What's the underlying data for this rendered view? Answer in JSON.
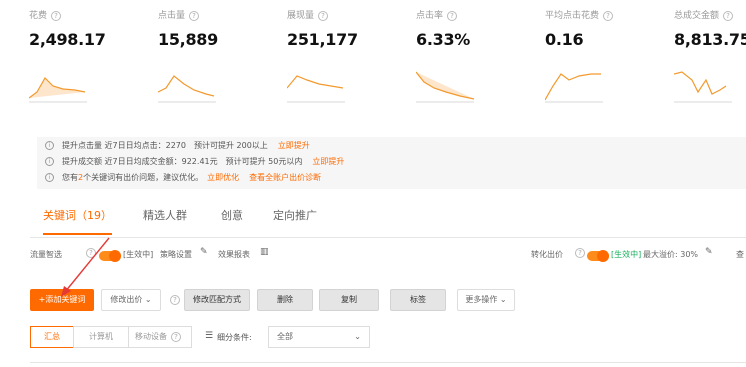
{
  "metrics": [
    {
      "label": "花费",
      "value": "2,498.17"
    },
    {
      "label": "点击量",
      "value": "15,889"
    },
    {
      "label": "展现量",
      "value": "251,177"
    },
    {
      "label": "点击率",
      "value": "6.33%"
    },
    {
      "label": "平均点击花费",
      "value": "0.16"
    },
    {
      "label": "总成交金额",
      "value": "8,813.75"
    }
  ],
  "help_glyph": "?",
  "alerts": [
    {
      "text": "提升点击量 近7日日均点击：2270　预计可提升 200以上",
      "link": "立即提升"
    },
    {
      "text": "提升成交额 近7日日均成交金额：922.41元　预计可提升 50元以内",
      "link": "立即提升"
    },
    {
      "pre": "您有",
      "count": "2",
      "post": "个关键词有出价问题，建议优化。",
      "link": "立即优化",
      "link2": "查看全账户出价诊断"
    }
  ],
  "tabs": [
    {
      "label": "关键词（19）",
      "active": true
    },
    {
      "label": "精选人群"
    },
    {
      "label": "创意"
    },
    {
      "label": "定向推广"
    }
  ],
  "controls": {
    "traffic_label": "流量智选",
    "traffic_status": "[生效中]",
    "strategy_label": "策略设置",
    "report_label": "效果报表",
    "conversion_label": "转化出价",
    "conversion_status": "[生效中]",
    "conversion_detail": "最大溢价: 30%",
    "edge_text": "查"
  },
  "toolbar": {
    "add_keyword": "+添加关键词",
    "modify_bid": "修改出价",
    "modify_match": "修改匹配方式",
    "delete": "删除",
    "copy": "复制",
    "tag": "标签",
    "more": "更多操作"
  },
  "filter": {
    "summary": "汇总",
    "computer": "计算机",
    "mobile": "移动设备",
    "condition_label": "细分条件:",
    "condition_value": "全部"
  },
  "colors": {
    "accent": "#ff6a00",
    "annotation_arrow": "#e53935"
  }
}
